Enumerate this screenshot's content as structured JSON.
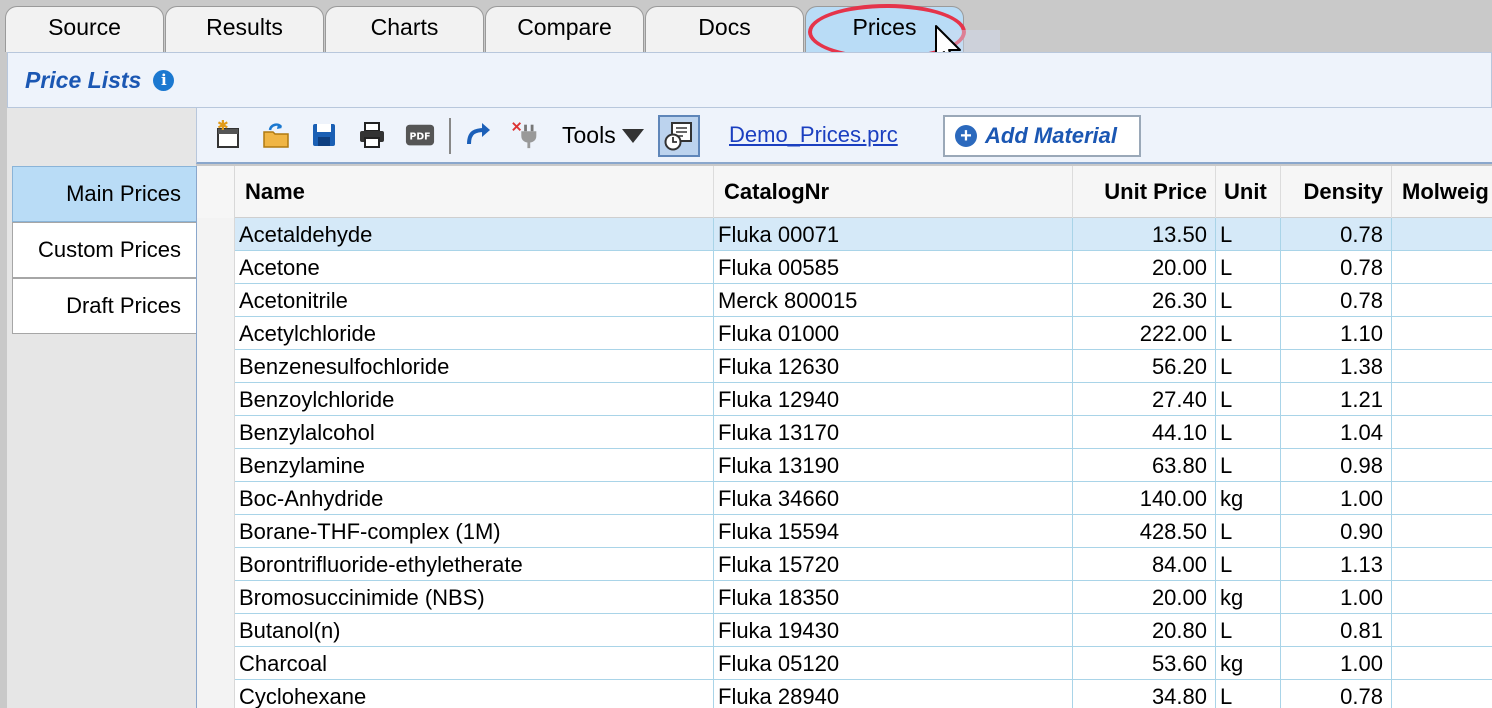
{
  "tabs": [
    {
      "label": "Source"
    },
    {
      "label": "Results"
    },
    {
      "label": "Charts"
    },
    {
      "label": "Compare"
    },
    {
      "label": "Docs"
    },
    {
      "label": "Prices",
      "active": true
    }
  ],
  "header": {
    "title": "Price Lists",
    "info_glyph": "i"
  },
  "toolbar": {
    "icons": [
      "new-file-icon",
      "open-folder-icon",
      "save-icon",
      "print-icon",
      "pdf-icon",
      "redo-icon",
      "disconnect-icon"
    ],
    "pdf_label": "PDF",
    "tools_label": "Tools",
    "file_link": "Demo_Prices.prc",
    "add_material_label": "Add Material"
  },
  "sidebar": {
    "items": [
      {
        "label": "Main Prices",
        "active": true
      },
      {
        "label": "Custom Prices"
      },
      {
        "label": "Draft Prices"
      }
    ]
  },
  "table": {
    "columns": [
      "Name",
      "CatalogNr",
      "Unit Price",
      "Unit",
      "Density",
      "Molweig"
    ],
    "rows": [
      {
        "name": "Acetaldehyde",
        "catalog": "Fluka 00071",
        "price": "13.50",
        "unit": "L",
        "density": "0.78",
        "selected": true
      },
      {
        "name": "Acetone",
        "catalog": "Fluka 00585",
        "price": "20.00",
        "unit": "L",
        "density": "0.78"
      },
      {
        "name": "Acetonitrile",
        "catalog": "Merck 800015",
        "price": "26.30",
        "unit": "L",
        "density": "0.78"
      },
      {
        "name": "Acetylchloride",
        "catalog": "Fluka 01000",
        "price": "222.00",
        "unit": "L",
        "density": "1.10"
      },
      {
        "name": "Benzenesulfochloride",
        "catalog": "Fluka 12630",
        "price": "56.20",
        "unit": "L",
        "density": "1.38"
      },
      {
        "name": "Benzoylchloride",
        "catalog": "Fluka 12940",
        "price": "27.40",
        "unit": "L",
        "density": "1.21"
      },
      {
        "name": "Benzylalcohol",
        "catalog": "Fluka 13170",
        "price": "44.10",
        "unit": "L",
        "density": "1.04"
      },
      {
        "name": "Benzylamine",
        "catalog": "Fluka 13190",
        "price": "63.80",
        "unit": "L",
        "density": "0.98"
      },
      {
        "name": "Boc-Anhydride",
        "catalog": "Fluka 34660",
        "price": "140.00",
        "unit": "kg",
        "density": "1.00"
      },
      {
        "name": "Borane-THF-complex (1M)",
        "catalog": "Fluka 15594",
        "price": "428.50",
        "unit": "L",
        "density": "0.90"
      },
      {
        "name": "Borontrifluoride-ethyletherate",
        "catalog": "Fluka 15720",
        "price": "84.00",
        "unit": "L",
        "density": "1.13"
      },
      {
        "name": "Bromosuccinimide (NBS)",
        "catalog": "Fluka 18350",
        "price": "20.00",
        "unit": "kg",
        "density": "1.00"
      },
      {
        "name": "Butanol(n)",
        "catalog": "Fluka 19430",
        "price": "20.80",
        "unit": "L",
        "density": "0.81"
      },
      {
        "name": "Charcoal",
        "catalog": "Fluka 05120",
        "price": "53.60",
        "unit": "kg",
        "density": "1.00"
      },
      {
        "name": "Cyclohexane",
        "catalog": "Fluka 28940",
        "price": "34.80",
        "unit": "L",
        "density": "0.78"
      }
    ]
  },
  "colors": {
    "accent": "#1b57b3",
    "active_tab": "#b9dcf6",
    "highlight": "#e5344a",
    "grid_line": "#a9d4e8"
  }
}
